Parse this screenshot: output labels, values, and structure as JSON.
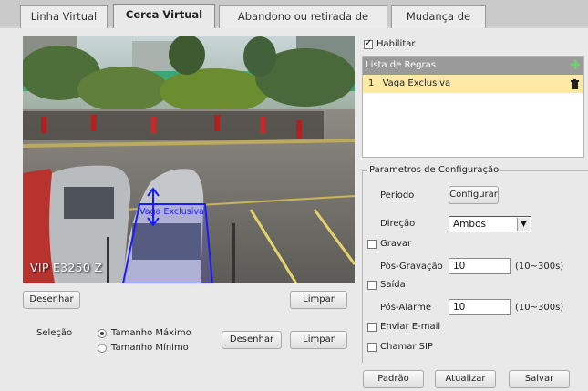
{
  "tabs": [
    {
      "label": "Linha Virtual",
      "active": false
    },
    {
      "label": "Cerca Virtual",
      "active": true
    },
    {
      "label": "Abandono ou retirada de objetos",
      "active": false
    },
    {
      "label": "Mudança de Cena",
      "active": false
    }
  ],
  "video": {
    "osd_text": "VIP E3250 Z",
    "zone_label": "Vaga Exclusiva"
  },
  "video_controls": {
    "draw_label": "Desenhar",
    "clear_label": "Limpar"
  },
  "selection": {
    "label": "Seleção",
    "options": [
      "Tamanho Máximo",
      "Tamanho Mínimo"
    ],
    "selected": "Tamanho Máximo",
    "draw_label": "Desenhar",
    "clear_label": "Limpar"
  },
  "enable": {
    "label": "Habilitar",
    "checked": true
  },
  "rules": {
    "header": "Lista de Regras",
    "items": [
      {
        "index": "1",
        "name": "Vaga Exclusiva"
      }
    ]
  },
  "config": {
    "legend": "Parametros de Configuração",
    "period_label": "Período",
    "configure_label": "Configurar",
    "direction_label": "Direção",
    "direction_value": "Ambos",
    "record_label": "Gravar",
    "record_checked": false,
    "post_record_label": "Pós-Gravação",
    "post_record_value": "10",
    "post_record_range": "(10~300s)",
    "output_label": "Saída",
    "output_checked": false,
    "post_alarm_label": "Pós-Alarme",
    "post_alarm_value": "10",
    "post_alarm_range": "(10~300s)",
    "email_label": "Enviar E-mail",
    "email_checked": false,
    "sip_label": "Chamar SIP",
    "sip_checked": false
  },
  "footer": {
    "default_label": "Padrão",
    "refresh_label": "Atualizar",
    "save_label": "Salvar"
  },
  "colors": {
    "zone": "#1a1aff",
    "rule_selected": "#fde9a4",
    "add_icon": "#4caf50"
  }
}
